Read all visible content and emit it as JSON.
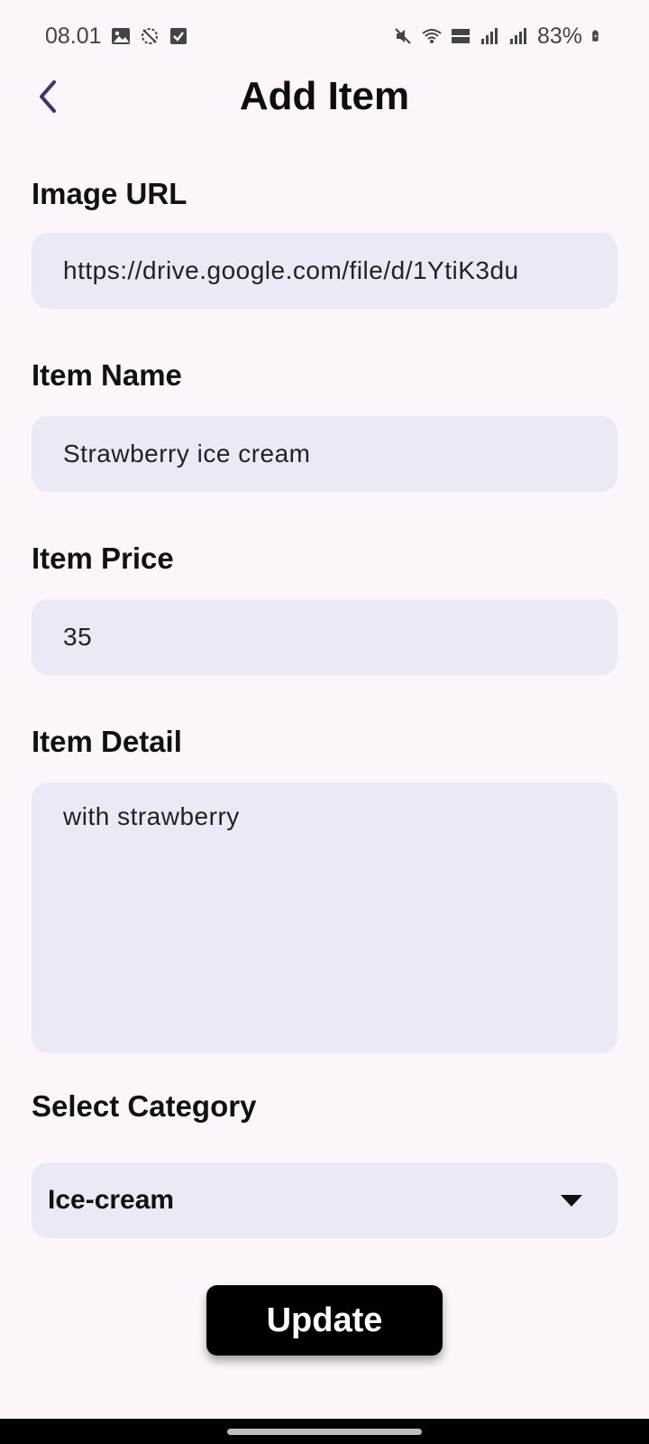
{
  "status_bar": {
    "time": "08.01",
    "battery": "83%"
  },
  "header": {
    "title": "Add Item"
  },
  "form": {
    "image_url": {
      "label": "Image URL",
      "value": "https://drive.google.com/file/d/1YtiK3du"
    },
    "item_name": {
      "label": "Item Name",
      "value": "Strawberry ice cream"
    },
    "item_price": {
      "label": "Item Price",
      "value": "35"
    },
    "item_detail": {
      "label": "Item Detail",
      "value": "with strawberry"
    },
    "category": {
      "label": "Select Category",
      "selected": "Ice-cream"
    }
  },
  "actions": {
    "update_label": "Update"
  },
  "colors": {
    "background": "#fcf6fc",
    "field_background": "#eae9f5",
    "button_background": "#000000",
    "back_icon": "#3b3a66"
  }
}
